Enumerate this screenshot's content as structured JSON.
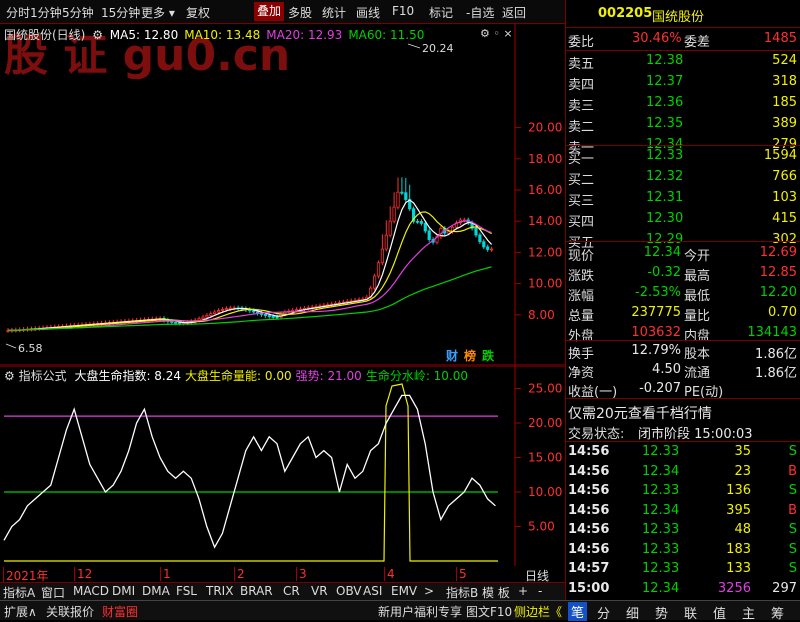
{
  "toolbar": {
    "items": [
      "分时",
      "1分钟",
      "5分钟",
      "15分钟",
      "更多",
      "复权",
      "叠加",
      "多股",
      "统计",
      "画线",
      "F10",
      "标记",
      "-自选",
      "返回"
    ]
  },
  "main_chart": {
    "stock_name": "国统股份(日线)",
    "ma_labels": [
      "MA5: 12.80",
      "MA10: 13.48",
      "MA20: 12.93",
      "MA60: 11.50"
    ],
    "ma_colors": [
      "#ffffff",
      "#f0f000",
      "#e040e0",
      "#00d000"
    ],
    "high_label": "20.24",
    "low_label": "6.58",
    "watermark": "股 证 gu0.cn",
    "badges": [
      "财",
      "榜",
      "跌"
    ],
    "y_ticks": [
      "20.00",
      "18.00",
      "16.00",
      "14.00",
      "12.00",
      "10.00",
      "8.00"
    ]
  },
  "indicator": {
    "title": "指标公式",
    "parts": [
      {
        "text": "大盘生命指数: 8.24",
        "color": "#ffffff"
      },
      {
        "text": "大盘生命量能: 0.00",
        "color": "#f0f000"
      },
      {
        "text": "强势: 21.00",
        "color": "#e040e0"
      },
      {
        "text": "生命分水岭: 10.00",
        "color": "#00d000"
      }
    ],
    "y_ticks": [
      "25.00",
      "20.00",
      "15.00",
      "10.00",
      "5.00"
    ]
  },
  "xaxis": {
    "labels": [
      "2021年",
      "12",
      "1",
      "2",
      "3",
      "4",
      "5"
    ],
    "right_label": "日线"
  },
  "tabs1": [
    "指标A",
    "窗口",
    "MACD",
    "DMI",
    "DMA",
    "FSL",
    "TRIX",
    "BRAR",
    "CR",
    "VR",
    "OBV",
    "ASI",
    "EMV",
    ">",
    "指标B",
    "模 板",
    "+",
    "-"
  ],
  "tabs2": {
    "left": [
      "扩展∧",
      "关联报价",
      "财富圈"
    ],
    "right": [
      "新用户福利专享",
      "图文F10",
      "侧边栏《"
    ]
  },
  "quote": {
    "code": "002205",
    "name": "国统股份",
    "weibi_label": "委比",
    "weibi": "30.46%",
    "weicha_label": "委差",
    "weicha": "1485",
    "asks": [
      {
        "label": "卖五",
        "price": "12.38",
        "vol": "524"
      },
      {
        "label": "卖四",
        "price": "12.37",
        "vol": "318"
      },
      {
        "label": "卖三",
        "price": "12.36",
        "vol": "185"
      },
      {
        "label": "卖二",
        "price": "12.35",
        "vol": "389"
      },
      {
        "label": "卖一",
        "price": "12.34",
        "vol": "279"
      }
    ],
    "bids": [
      {
        "label": "买一",
        "price": "12.33",
        "vol": "1594"
      },
      {
        "label": "买二",
        "price": "12.32",
        "vol": "766"
      },
      {
        "label": "买三",
        "price": "12.31",
        "vol": "103"
      },
      {
        "label": "买四",
        "price": "12.30",
        "vol": "415"
      },
      {
        "label": "买五",
        "price": "12.29",
        "vol": "302"
      }
    ],
    "stats": [
      {
        "l1": "现价",
        "v1": "12.34",
        "c1": "green",
        "l2": "今开",
        "v2": "12.69",
        "c2": "red"
      },
      {
        "l1": "涨跌",
        "v1": "-0.32",
        "c1": "green",
        "l2": "最高",
        "v2": "12.85",
        "c2": "red"
      },
      {
        "l1": "涨幅",
        "v1": "-2.53%",
        "c1": "green",
        "l2": "最低",
        "v2": "12.20",
        "c2": "green"
      },
      {
        "l1": "总量",
        "v1": "237775",
        "c1": "yellow",
        "l2": "量比",
        "v2": "0.70",
        "c2": "yellow"
      },
      {
        "l1": "外盘",
        "v1": "103632",
        "c1": "red",
        "l2": "内盘",
        "v2": "134143",
        "c2": "green"
      }
    ],
    "stats2": [
      {
        "l1": "换手",
        "v1": "12.79%",
        "l2": "股本",
        "v2": "1.86亿"
      },
      {
        "l1": "净资",
        "v1": "4.50",
        "l2": "流通",
        "v2": "1.86亿"
      },
      {
        "l1": "收益(一)",
        "v1": "-0.207",
        "l2": "PE(动)",
        "v2": ""
      }
    ],
    "promo": "仅需20元查看千档行情",
    "status_label": "交易状态:",
    "status": "闭市阶段 15:00:03",
    "ticks": [
      {
        "t": "14:56",
        "p": "12.33",
        "pc": "green",
        "v": "35",
        "s": "S",
        "sc": "green"
      },
      {
        "t": "14:56",
        "p": "12.34",
        "pc": "green",
        "v": "23",
        "s": "B",
        "sc": "red"
      },
      {
        "t": "14:56",
        "p": "12.33",
        "pc": "green",
        "v": "136",
        "s": "S",
        "sc": "green"
      },
      {
        "t": "14:56",
        "p": "12.34",
        "pc": "green",
        "v": "395",
        "s": "B",
        "sc": "red"
      },
      {
        "t": "14:56",
        "p": "12.33",
        "pc": "green",
        "v": "48",
        "s": "S",
        "sc": "green"
      },
      {
        "t": "14:56",
        "p": "12.33",
        "pc": "green",
        "v": "183",
        "s": "S",
        "sc": "green"
      },
      {
        "t": "14:57",
        "p": "12.33",
        "pc": "green",
        "v": "133",
        "s": "S",
        "sc": "green"
      },
      {
        "t": "15:00",
        "p": "12.34",
        "pc": "green",
        "v": "3256",
        "s": "297",
        "sc": "white"
      }
    ]
  },
  "bottom_tabs": [
    "笔",
    "分",
    "细",
    "势",
    "联",
    "值",
    "主",
    "筹"
  ]
}
